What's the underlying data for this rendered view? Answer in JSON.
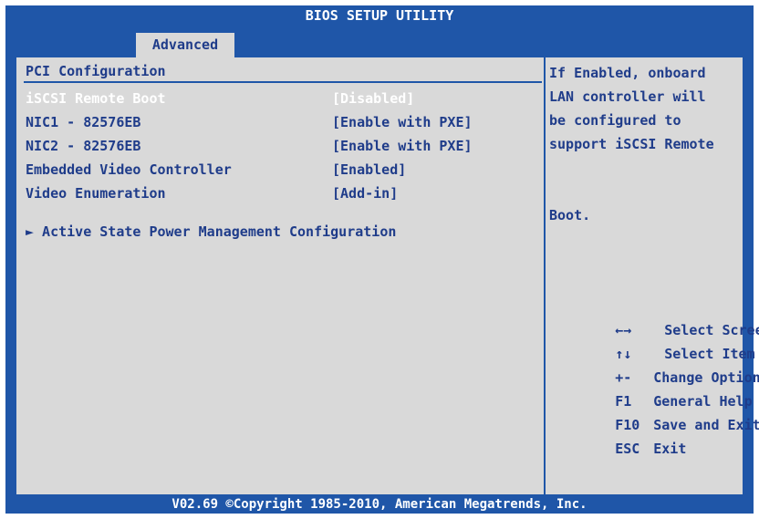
{
  "window": {
    "title": "BIOS SETUP UTILITY"
  },
  "tabs": [
    {
      "label": "Advanced",
      "active": true
    }
  ],
  "section": {
    "title": "PCI Configuration"
  },
  "items": [
    {
      "label": "iSCSI Remote Boot",
      "value": "[Disabled]",
      "selected": true
    },
    {
      "label": "NIC1 - 82576EB",
      "value": "[Enable with PXE]",
      "selected": false
    },
    {
      "label": "NIC2 - 82576EB",
      "value": "[Enable with PXE]",
      "selected": false
    },
    {
      "label": "Embedded Video Controller",
      "value": "[Enabled]",
      "selected": false
    },
    {
      "label": "Video Enumeration",
      "value": "[Add-in]",
      "selected": false
    }
  ],
  "submenu": {
    "label": "► Active State Power Management Configuration"
  },
  "help": {
    "lines": [
      "If Enabled, onboard",
      "LAN controller will",
      "be configured to",
      "support iSCSI Remote",
      "",
      "",
      "Boot."
    ]
  },
  "legend": [
    {
      "key": "←→",
      "action": "Select Screen",
      "icon": "left-right-arrows-icon"
    },
    {
      "key": "↑↓",
      "action": "Select Item",
      "icon": "up-down-arrows-icon"
    },
    {
      "key": "+-",
      "action": "Change Option"
    },
    {
      "key": "F1",
      "action": "General Help"
    },
    {
      "key": "F10",
      "action": "Save and Exit"
    },
    {
      "key": "ESC",
      "action": "Exit"
    }
  ],
  "footer": {
    "text": "V02.69 ©Copyright 1985-2010, American Megatrends, Inc."
  },
  "colors": {
    "bios_blue": "#1f56a8",
    "panel_gray": "#d9d9d9",
    "text_navy": "#1f3c8a",
    "selected_text": "#ffffff"
  }
}
